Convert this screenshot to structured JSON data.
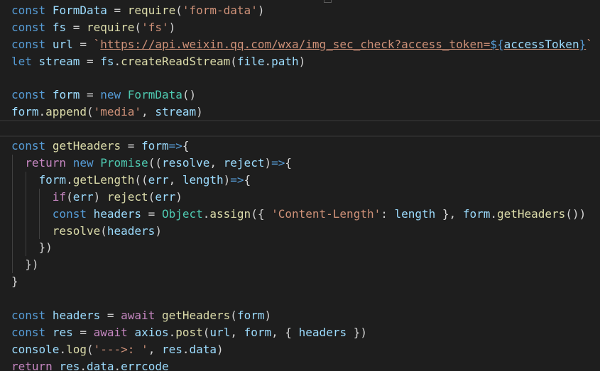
{
  "editor": {
    "theme": {
      "background": "#1e1e1e",
      "keyword": "#569cd6",
      "control": "#c586c0",
      "variable": "#9cdcfe",
      "function": "#dcdcaa",
      "string": "#ce9178",
      "class": "#4ec9b0",
      "plain": "#d4d4d4"
    },
    "cursor_line_index": 7,
    "lines": [
      [
        [
          "const",
          "keyword"
        ],
        [
          " ",
          "plain"
        ],
        [
          "FormData",
          "variable"
        ],
        [
          " = ",
          "plain"
        ],
        [
          "require",
          "function"
        ],
        [
          "(",
          "plain"
        ],
        [
          "'form-data'",
          "string"
        ],
        [
          ")",
          "plain"
        ]
      ],
      [
        [
          "const",
          "keyword"
        ],
        [
          " ",
          "plain"
        ],
        [
          "fs",
          "variable"
        ],
        [
          " = ",
          "plain"
        ],
        [
          "require",
          "function"
        ],
        [
          "(",
          "plain"
        ],
        [
          "'fs'",
          "string"
        ],
        [
          ")",
          "plain"
        ]
      ],
      [
        [
          "const",
          "keyword"
        ],
        [
          " ",
          "plain"
        ],
        [
          "url",
          "variable"
        ],
        [
          " = ",
          "plain"
        ],
        [
          "`",
          "string"
        ],
        [
          "https://api.weixin.qq.com/wxa/img_sec_check?access_token=",
          "url"
        ],
        [
          "${",
          "tmplbrace"
        ],
        [
          "accessToken",
          "url-var"
        ],
        [
          "}",
          "tmplbrace"
        ],
        [
          "`",
          "string"
        ]
      ],
      [
        [
          "let",
          "keyword"
        ],
        [
          " ",
          "plain"
        ],
        [
          "stream",
          "variable"
        ],
        [
          " = ",
          "plain"
        ],
        [
          "fs",
          "variable"
        ],
        [
          ".",
          "plain"
        ],
        [
          "createReadStream",
          "function"
        ],
        [
          "(",
          "plain"
        ],
        [
          "file",
          "variable"
        ],
        [
          ".",
          "plain"
        ],
        [
          "path",
          "variable"
        ],
        [
          ")",
          "plain"
        ]
      ],
      [],
      [
        [
          "const",
          "keyword"
        ],
        [
          " ",
          "plain"
        ],
        [
          "form",
          "variable"
        ],
        [
          " = ",
          "plain"
        ],
        [
          "new",
          "keyword"
        ],
        [
          " ",
          "plain"
        ],
        [
          "FormData",
          "class"
        ],
        [
          "()",
          "plain"
        ]
      ],
      [
        [
          "form",
          "variable"
        ],
        [
          ".",
          "plain"
        ],
        [
          "append",
          "function"
        ],
        [
          "(",
          "plain"
        ],
        [
          "'media'",
          "string"
        ],
        [
          ", ",
          "plain"
        ],
        [
          "stream",
          "variable"
        ],
        [
          ")",
          "plain"
        ]
      ],
      [],
      [
        [
          "const",
          "keyword"
        ],
        [
          " ",
          "plain"
        ],
        [
          "getHeaders",
          "function"
        ],
        [
          " = ",
          "plain"
        ],
        [
          "form",
          "variable"
        ],
        [
          "=>",
          "keyword"
        ],
        [
          "{",
          "plain"
        ]
      ],
      [
        [
          "  ",
          "plain"
        ],
        [
          "return",
          "control"
        ],
        [
          " ",
          "plain"
        ],
        [
          "new",
          "keyword"
        ],
        [
          " ",
          "plain"
        ],
        [
          "Promise",
          "class"
        ],
        [
          "((",
          "plain"
        ],
        [
          "resolve",
          "variable"
        ],
        [
          ", ",
          "plain"
        ],
        [
          "reject",
          "variable"
        ],
        [
          ")",
          "plain"
        ],
        [
          "=>",
          "keyword"
        ],
        [
          "{",
          "plain"
        ]
      ],
      [
        [
          "    ",
          "plain"
        ],
        [
          "form",
          "variable"
        ],
        [
          ".",
          "plain"
        ],
        [
          "getLength",
          "function"
        ],
        [
          "((",
          "plain"
        ],
        [
          "err",
          "variable"
        ],
        [
          ", ",
          "plain"
        ],
        [
          "length",
          "variable"
        ],
        [
          ")",
          "plain"
        ],
        [
          "=>",
          "keyword"
        ],
        [
          "{",
          "plain"
        ]
      ],
      [
        [
          "      ",
          "plain"
        ],
        [
          "if",
          "control"
        ],
        [
          "(",
          "plain"
        ],
        [
          "err",
          "variable"
        ],
        [
          ") ",
          "plain"
        ],
        [
          "reject",
          "function"
        ],
        [
          "(",
          "plain"
        ],
        [
          "err",
          "variable"
        ],
        [
          ")",
          "plain"
        ]
      ],
      [
        [
          "      ",
          "plain"
        ],
        [
          "const",
          "keyword"
        ],
        [
          " ",
          "plain"
        ],
        [
          "headers",
          "variable"
        ],
        [
          " = ",
          "plain"
        ],
        [
          "Object",
          "class"
        ],
        [
          ".",
          "plain"
        ],
        [
          "assign",
          "function"
        ],
        [
          "({ ",
          "plain"
        ],
        [
          "'Content-Length'",
          "string"
        ],
        [
          ": ",
          "plain"
        ],
        [
          "length",
          "variable"
        ],
        [
          " }, ",
          "plain"
        ],
        [
          "form",
          "variable"
        ],
        [
          ".",
          "plain"
        ],
        [
          "getHeaders",
          "function"
        ],
        [
          "())",
          "plain"
        ]
      ],
      [
        [
          "      ",
          "plain"
        ],
        [
          "resolve",
          "function"
        ],
        [
          "(",
          "plain"
        ],
        [
          "headers",
          "variable"
        ],
        [
          ")",
          "plain"
        ]
      ],
      [
        [
          "    ",
          "plain"
        ],
        [
          "})",
          "plain"
        ]
      ],
      [
        [
          "  ",
          "plain"
        ],
        [
          "})",
          "plain"
        ]
      ],
      [
        [
          "}",
          "plain"
        ]
      ],
      [],
      [
        [
          "const",
          "keyword"
        ],
        [
          " ",
          "plain"
        ],
        [
          "headers",
          "variable"
        ],
        [
          " = ",
          "plain"
        ],
        [
          "await",
          "control"
        ],
        [
          " ",
          "plain"
        ],
        [
          "getHeaders",
          "function"
        ],
        [
          "(",
          "plain"
        ],
        [
          "form",
          "variable"
        ],
        [
          ")",
          "plain"
        ]
      ],
      [
        [
          "const",
          "keyword"
        ],
        [
          " ",
          "plain"
        ],
        [
          "res",
          "variable"
        ],
        [
          " = ",
          "plain"
        ],
        [
          "await",
          "control"
        ],
        [
          " ",
          "plain"
        ],
        [
          "axios",
          "variable"
        ],
        [
          ".",
          "plain"
        ],
        [
          "post",
          "function"
        ],
        [
          "(",
          "plain"
        ],
        [
          "url",
          "variable"
        ],
        [
          ", ",
          "plain"
        ],
        [
          "form",
          "variable"
        ],
        [
          ", { ",
          "plain"
        ],
        [
          "headers",
          "variable"
        ],
        [
          " })",
          "plain"
        ]
      ],
      [
        [
          "console",
          "variable"
        ],
        [
          ".",
          "plain"
        ],
        [
          "log",
          "function"
        ],
        [
          "(",
          "plain"
        ],
        [
          "'--->: '",
          "string"
        ],
        [
          ", ",
          "plain"
        ],
        [
          "res",
          "variable"
        ],
        [
          ".",
          "plain"
        ],
        [
          "data",
          "variable"
        ],
        [
          ")",
          "plain"
        ]
      ],
      [
        [
          "return",
          "control"
        ],
        [
          " ",
          "plain"
        ],
        [
          "res",
          "variable"
        ],
        [
          ".",
          "plain"
        ],
        [
          "data",
          "variable"
        ],
        [
          ".",
          "plain"
        ],
        [
          "errcode",
          "variable"
        ]
      ]
    ]
  }
}
